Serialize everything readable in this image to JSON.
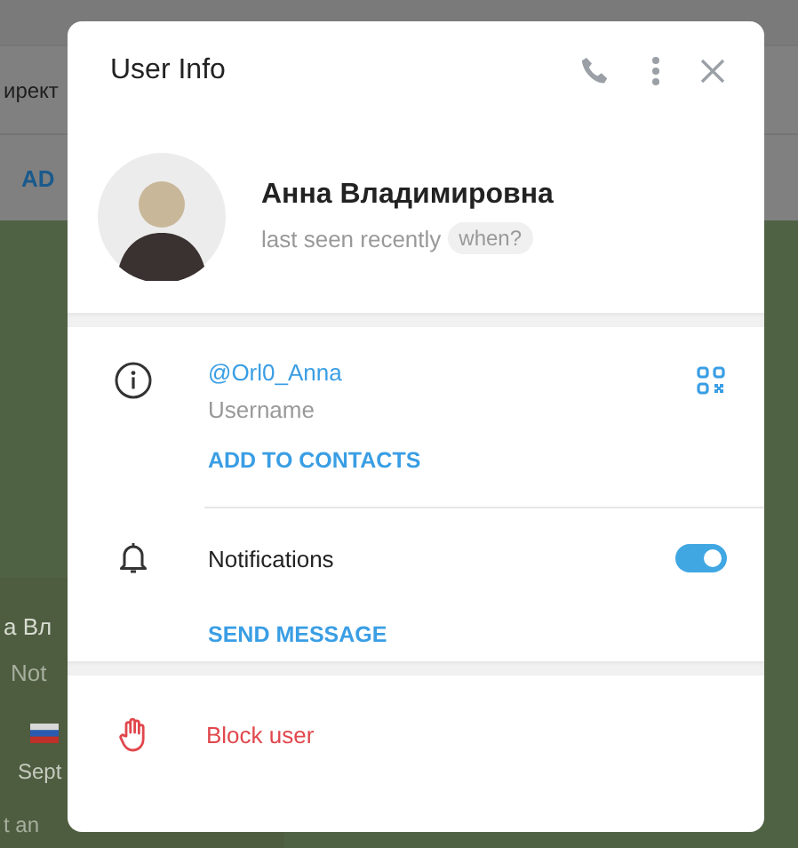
{
  "background": {
    "search_text": "ирект",
    "action": "AD",
    "panel": {
      "name": "а Вл",
      "note": "Not",
      "row_2_b": "Sept",
      "footer": "t an"
    }
  },
  "dialog": {
    "title": "User Info",
    "profile": {
      "name": "Анна Владимировна",
      "status": "last seen recently",
      "when_button": "when?"
    },
    "username": {
      "value": "@Orl0_Anna",
      "label": "Username"
    },
    "add_contact": "ADD TO CONTACTS",
    "notifications": {
      "label": "Notifications",
      "on": true
    },
    "send_message": "SEND MESSAGE",
    "block": "Block user"
  }
}
